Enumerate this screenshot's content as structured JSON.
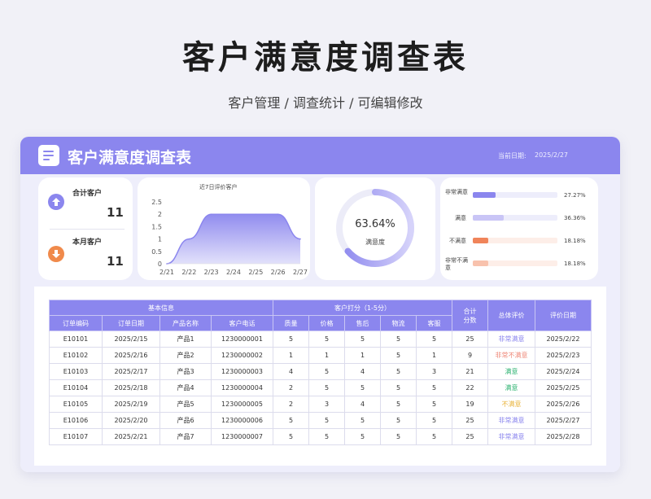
{
  "page": {
    "title": "客户满意度调查表",
    "subtitle": "客户管理 / 调查统计 /  可编辑修改"
  },
  "header": {
    "title": "客户满意度调查表",
    "date_label": "当前日期:",
    "date_value": "2025/2/27",
    "icon": "document-icon"
  },
  "stats": {
    "total_label": "合计客户",
    "total_value": "11",
    "total_icon": "arrow-up-icon",
    "total_color": "#8b86ee",
    "month_label": "本月客户",
    "month_value": "11",
    "month_icon": "arrow-down-icon",
    "month_color": "#f08a4b"
  },
  "donut": {
    "percent_text": "63.64%",
    "percent": 63.64,
    "label": "满意度"
  },
  "chart_data": {
    "type": "area",
    "title": "近7日评价客户",
    "categories": [
      "2/21",
      "2/22",
      "2/23",
      "2/24",
      "2/25",
      "2/26",
      "2/27"
    ],
    "values": [
      0,
      1,
      2,
      2,
      2,
      2,
      1
    ],
    "ylim": [
      0,
      2.5
    ],
    "yticks": [
      "0",
      "0.5",
      "1",
      "1.5",
      "2",
      "2.5"
    ],
    "color": "#8b86ee"
  },
  "ratings": [
    {
      "label": "非常满意",
      "percent_text": "27.27%",
      "value": 27.27,
      "color": "#8b86ee",
      "track": "#ededfb"
    },
    {
      "label": "满意",
      "percent_text": "36.36%",
      "value": 36.36,
      "color": "#c9c5f6",
      "track": "#ededfb"
    },
    {
      "label": "不满意",
      "percent_text": "18.18%",
      "value": 18.18,
      "color": "#f0845a",
      "track": "#fdeee8"
    },
    {
      "label": "非常不满意",
      "percent_text": "18.18%",
      "value": 18.18,
      "color": "#f8c2ad",
      "track": "#fdeee8"
    }
  ],
  "table": {
    "group_basic": "基本信息",
    "group_score": "客户打分（1-5分）",
    "total_header": "合计分数",
    "overall_header": "总体评价",
    "date_header": "评价日期",
    "basic_columns": [
      "订单编码",
      "订单日期",
      "产品名称",
      "客户电话"
    ],
    "score_columns": [
      "质量",
      "价格",
      "售后",
      "物流",
      "客服"
    ],
    "rows": [
      {
        "cells": [
          "E10101",
          "2025/2/15",
          "产品1",
          "1230000001",
          "5",
          "5",
          "5",
          "5",
          "5",
          "25"
        ],
        "rating": "非常满意",
        "rating_class": "tag-very-satisfied",
        "date": "2025/2/22"
      },
      {
        "cells": [
          "E10102",
          "2025/2/16",
          "产品2",
          "1230000002",
          "1",
          "1",
          "1",
          "5",
          "1",
          "9"
        ],
        "rating": "非常不满意",
        "rating_class": "tag-very-unsatisfied",
        "date": "2025/2/23"
      },
      {
        "cells": [
          "E10103",
          "2025/2/17",
          "产品3",
          "1230000003",
          "4",
          "5",
          "4",
          "5",
          "3",
          "21"
        ],
        "rating": "满意",
        "rating_class": "tag-satisfied",
        "date": "2025/2/24"
      },
      {
        "cells": [
          "E10104",
          "2025/2/18",
          "产品4",
          "1230000004",
          "2",
          "5",
          "5",
          "5",
          "5",
          "22"
        ],
        "rating": "满意",
        "rating_class": "tag-satisfied",
        "date": "2025/2/25"
      },
      {
        "cells": [
          "E10105",
          "2025/2/19",
          "产品5",
          "1230000005",
          "2",
          "3",
          "4",
          "5",
          "5",
          "19"
        ],
        "rating": "不满意",
        "rating_class": "tag-unsatisfied",
        "date": "2025/2/26"
      },
      {
        "cells": [
          "E10106",
          "2025/2/20",
          "产品6",
          "1230000006",
          "5",
          "5",
          "5",
          "5",
          "5",
          "25"
        ],
        "rating": "非常满意",
        "rating_class": "tag-very-satisfied",
        "date": "2025/2/27"
      },
      {
        "cells": [
          "E10107",
          "2025/2/21",
          "产品7",
          "1230000007",
          "5",
          "5",
          "5",
          "5",
          "5",
          "25"
        ],
        "rating": "非常满意",
        "rating_class": "tag-very-satisfied",
        "date": "2025/2/28"
      }
    ]
  }
}
